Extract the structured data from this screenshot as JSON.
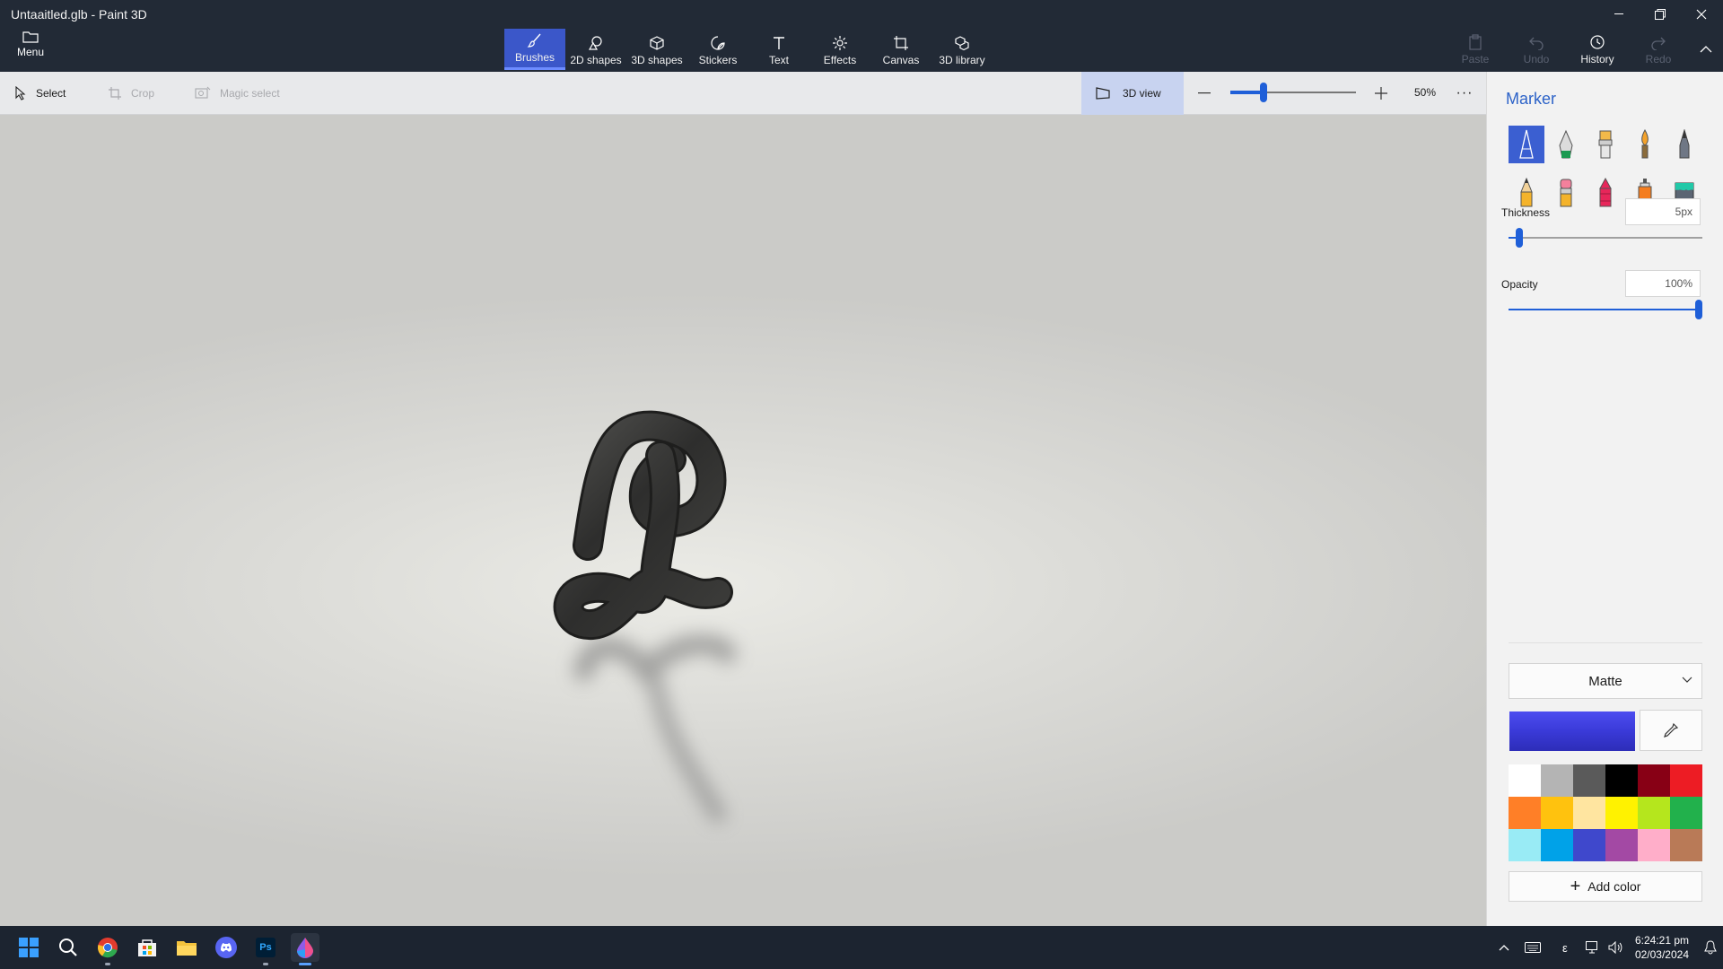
{
  "window": {
    "title": "Untaaitled.glb - Paint 3D"
  },
  "menu": {
    "label": "Menu"
  },
  "tools": [
    {
      "label": "Brushes",
      "icon": "brush-icon",
      "active": true
    },
    {
      "label": "2D shapes",
      "icon": "2d-shapes-icon",
      "active": false
    },
    {
      "label": "3D shapes",
      "icon": "3d-shapes-icon",
      "active": false
    },
    {
      "label": "Stickers",
      "icon": "stickers-icon",
      "active": false
    },
    {
      "label": "Text",
      "icon": "text-icon",
      "active": false
    },
    {
      "label": "Effects",
      "icon": "effects-icon",
      "active": false
    },
    {
      "label": "Canvas",
      "icon": "canvas-icon",
      "active": false
    },
    {
      "label": "3D library",
      "icon": "3d-library-icon",
      "active": false
    }
  ],
  "right_tools": {
    "paste": "Paste",
    "undo": "Undo",
    "history": "History",
    "redo": "Redo"
  },
  "subbar": {
    "select": "Select",
    "crop": "Crop",
    "magic_select": "Magic select",
    "view3d": "3D view",
    "zoom": "50%",
    "zoom_fraction": 0.25,
    "more": "···"
  },
  "panel": {
    "title": "Marker",
    "brushes": [
      {
        "name": "marker-brush",
        "selected": true
      },
      {
        "name": "calligraphy-pen-brush",
        "selected": false
      },
      {
        "name": "oil-brush",
        "selected": false
      },
      {
        "name": "watercolor-brush",
        "selected": false
      },
      {
        "name": "pixel-pen-brush",
        "selected": false
      },
      {
        "name": "pencil-brush",
        "selected": false
      },
      {
        "name": "eraser-brush",
        "selected": false
      },
      {
        "name": "crayon-brush",
        "selected": false
      },
      {
        "name": "spray-can-brush",
        "selected": false
      },
      {
        "name": "fill-bucket-brush",
        "selected": false
      }
    ],
    "thickness_label": "Thickness",
    "thickness_value": "5px",
    "thickness_fraction": 0.04,
    "opacity_label": "Opacity",
    "opacity_value": "100%",
    "opacity_fraction": 1.0,
    "finish": "Matte",
    "current_color": "#3a3ad8",
    "palette": [
      "#ffffff",
      "#b4b4b4",
      "#5a5a5a",
      "#000000",
      "#880015",
      "#ed1c24",
      "#ff7f27",
      "#ffc20e",
      "#ffe5a0",
      "#fff200",
      "#b5e61d",
      "#22b14c",
      "#99ebf5",
      "#00a2e8",
      "#3f48cc",
      "#a349a4",
      "#ffaec9",
      "#b97a57"
    ],
    "add_color": "Add color"
  },
  "taskbar": {
    "apps": [
      "start-icon",
      "search-icon",
      "chrome-icon",
      "store-icon",
      "file-explorer-icon",
      "discord-icon",
      "photoshop-icon",
      "paint3d-icon"
    ],
    "photoshop_label": "Ps",
    "ime": "ε",
    "time": "6:24:21 pm",
    "date": "02/03/2024"
  },
  "accent": "#3b57c9"
}
